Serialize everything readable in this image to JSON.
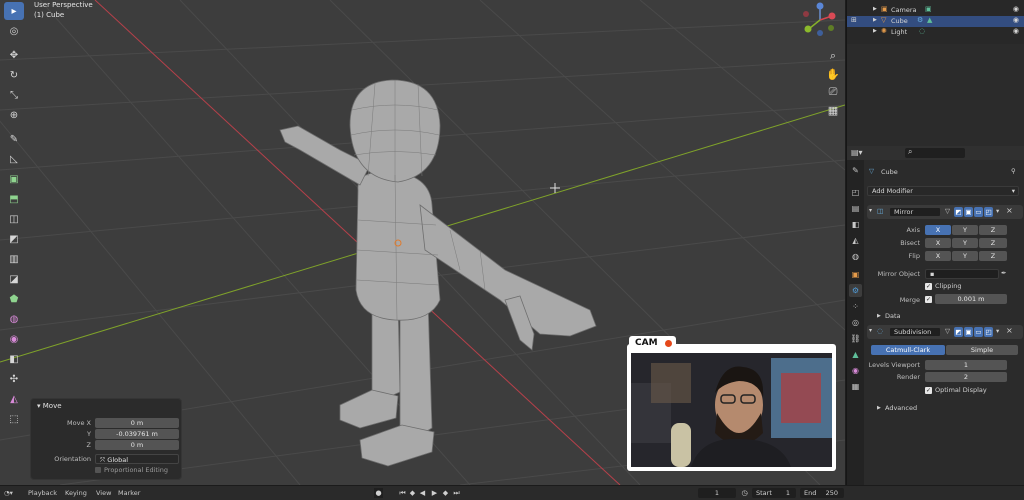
{
  "viewport": {
    "title": "User Perspective",
    "subtitle": "(1) Cube"
  },
  "toolbar": {
    "tools": [
      {
        "name": "select-tool",
        "icon": "▸"
      },
      {
        "name": "cursor-tool",
        "icon": "◎"
      },
      {
        "name": "move-tool",
        "icon": "✥"
      },
      {
        "name": "rotate-tool",
        "icon": "↻"
      },
      {
        "name": "scale-tool",
        "icon": "⤡"
      },
      {
        "name": "transform-tool",
        "icon": "⊕"
      },
      {
        "name": "annotate-tool",
        "icon": "✎"
      },
      {
        "name": "measure-tool",
        "icon": "◺"
      },
      {
        "name": "add-cube-tool",
        "icon": "▣"
      },
      {
        "name": "extrude-tool",
        "icon": "⬒"
      },
      {
        "name": "inset-tool",
        "icon": "◫"
      },
      {
        "name": "bevel-tool",
        "icon": "◩"
      },
      {
        "name": "loop-cut-tool",
        "icon": "▥"
      },
      {
        "name": "knife-tool",
        "icon": "◪"
      },
      {
        "name": "poly-build-tool",
        "icon": "⬟"
      },
      {
        "name": "spin-tool",
        "icon": "◍"
      },
      {
        "name": "smooth-tool",
        "icon": "◉"
      },
      {
        "name": "edge-slide-tool",
        "icon": "◧"
      },
      {
        "name": "shrink-tool",
        "icon": "✣"
      },
      {
        "name": "shear-tool",
        "icon": "◭"
      },
      {
        "name": "rip-tool",
        "icon": "⬚"
      }
    ]
  },
  "move_panel": {
    "title": "Move",
    "fields": [
      {
        "label": "Move X",
        "value": "0 m"
      },
      {
        "label": "Y",
        "value": "-0.039761 m"
      },
      {
        "label": "Z",
        "value": "0 m"
      }
    ],
    "orientation_label": "Orientation",
    "orientation_value": "Global",
    "proportional_label": "Proportional Editing"
  },
  "cam": {
    "label": "CAM"
  },
  "timeline": {
    "menus": [
      "Playback",
      "Keying",
      "View",
      "Marker"
    ],
    "current_frame": "1",
    "start_label": "Start",
    "start_value": "1",
    "end_label": "End",
    "end_value": "250"
  },
  "outliner": {
    "rows": [
      {
        "label": "Camera",
        "selected": false
      },
      {
        "label": "Cube",
        "selected": true
      },
      {
        "label": "Light",
        "selected": false
      }
    ]
  },
  "properties": {
    "object_name": "Cube",
    "add_modifier": "Add Modifier",
    "mirror": {
      "name": "Mirror",
      "axis_label": "Axis",
      "bisect_label": "Bisect",
      "flip_label": "Flip",
      "axes": [
        "X",
        "Y",
        "Z"
      ],
      "mirror_object_label": "Mirror Object",
      "clipping_label": "Clipping",
      "merge_label": "Merge",
      "merge_value": "0.001 m",
      "data_label": "Data"
    },
    "subdivision": {
      "name": "Subdivision",
      "tab_catmull": "Catmull-Clark",
      "tab_simple": "Simple",
      "levels_viewport_label": "Levels Viewport",
      "levels_viewport_value": "1",
      "render_label": "Render",
      "render_value": "2",
      "optimal_display_label": "Optimal Display",
      "advanced_label": "Advanced"
    }
  },
  "colors": {
    "accent": "#4772b3",
    "cam_dot": "#e5481a",
    "axis_x": "#b5404a",
    "axis_y": "#7fa22a"
  }
}
